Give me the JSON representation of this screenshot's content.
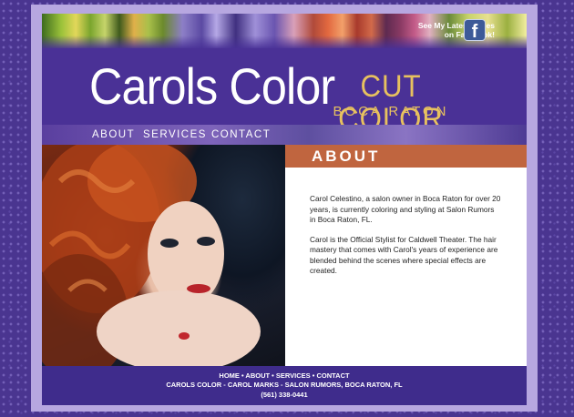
{
  "header": {
    "facebook_line1": "See My Latest Styles",
    "facebook_line2": "on Facebook!",
    "facebook_icon_glyph": "f",
    "brand_name": "Carols Color",
    "tagline": "CUT COLOR STYLE",
    "location": "BOCA RATON"
  },
  "nav": {
    "about": "ABOUT",
    "services": "SERVICES",
    "contact": "CONTACT"
  },
  "main": {
    "section_title": "ABOUT",
    "paragraph1": "Carol Celestino, a salon owner in Boca Raton for over 20 years, is currently coloring and styling at Salon Rumors in Boca Raton, FL.",
    "paragraph2": "Carol is the Official Stylist for Caldwell Theater. The hair mastery that comes with Carol's years of experience are blended behind the scenes where special effects are created."
  },
  "footer": {
    "nav_home": "HOME",
    "nav_about": "ABOUT",
    "nav_services": "SERVICES",
    "nav_contact": "CONTACT",
    "separator": " • ",
    "address": "CAROLS COLOR - CAROL MARKS - SALON RUMORS, BOCA RATON, FL",
    "phone": "(561) 338-0441"
  },
  "colors": {
    "banner": "#4a3196",
    "gold": "#e7c15f",
    "section_header": "#c0653f",
    "footer": "#3f2c8c"
  }
}
